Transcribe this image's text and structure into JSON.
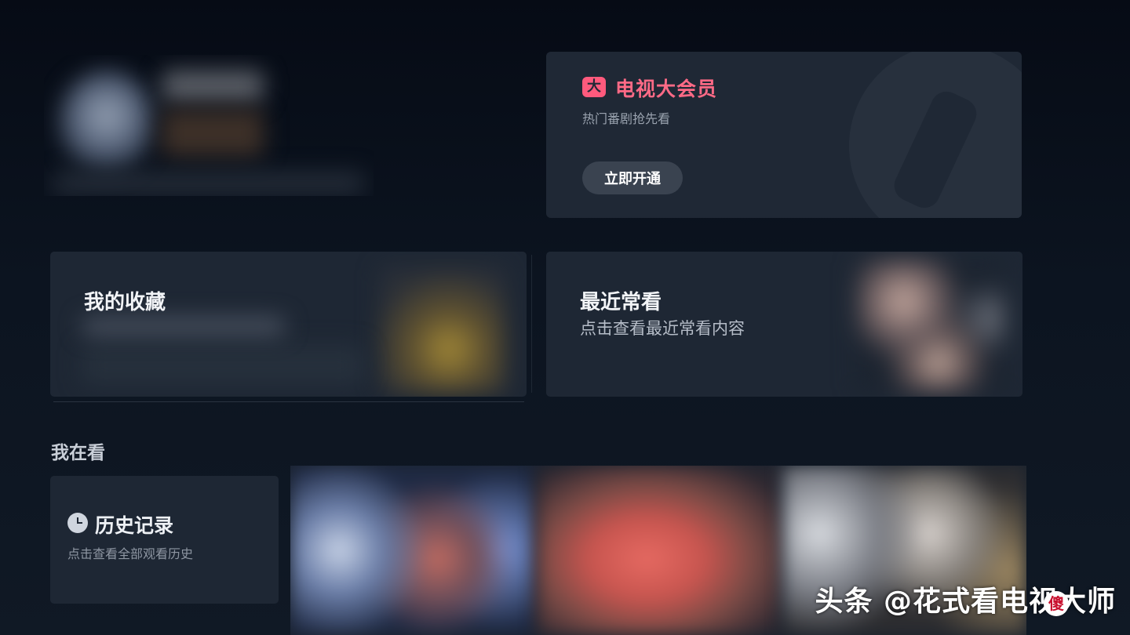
{
  "vip": {
    "badge": "大",
    "title": "电视大会员",
    "subtitle": "热门番剧抢先看",
    "button": "立即开通"
  },
  "favorites": {
    "title": "我的收藏"
  },
  "recent": {
    "title": "最近常看",
    "subtitle": "点击查看最近常看内容"
  },
  "watching": {
    "section_title": "我在看",
    "history_title": "历史记录",
    "history_subtitle": "点击查看全部观看历史"
  },
  "watermark": {
    "text": "头条 @花式看电视大师",
    "stamp": "傻"
  },
  "colors": {
    "accent": "#ff6a86",
    "card": "#1e2734",
    "background": "#0c1420"
  },
  "icons": {
    "vip": "vip-badge-icon",
    "history": "clock-icon"
  }
}
